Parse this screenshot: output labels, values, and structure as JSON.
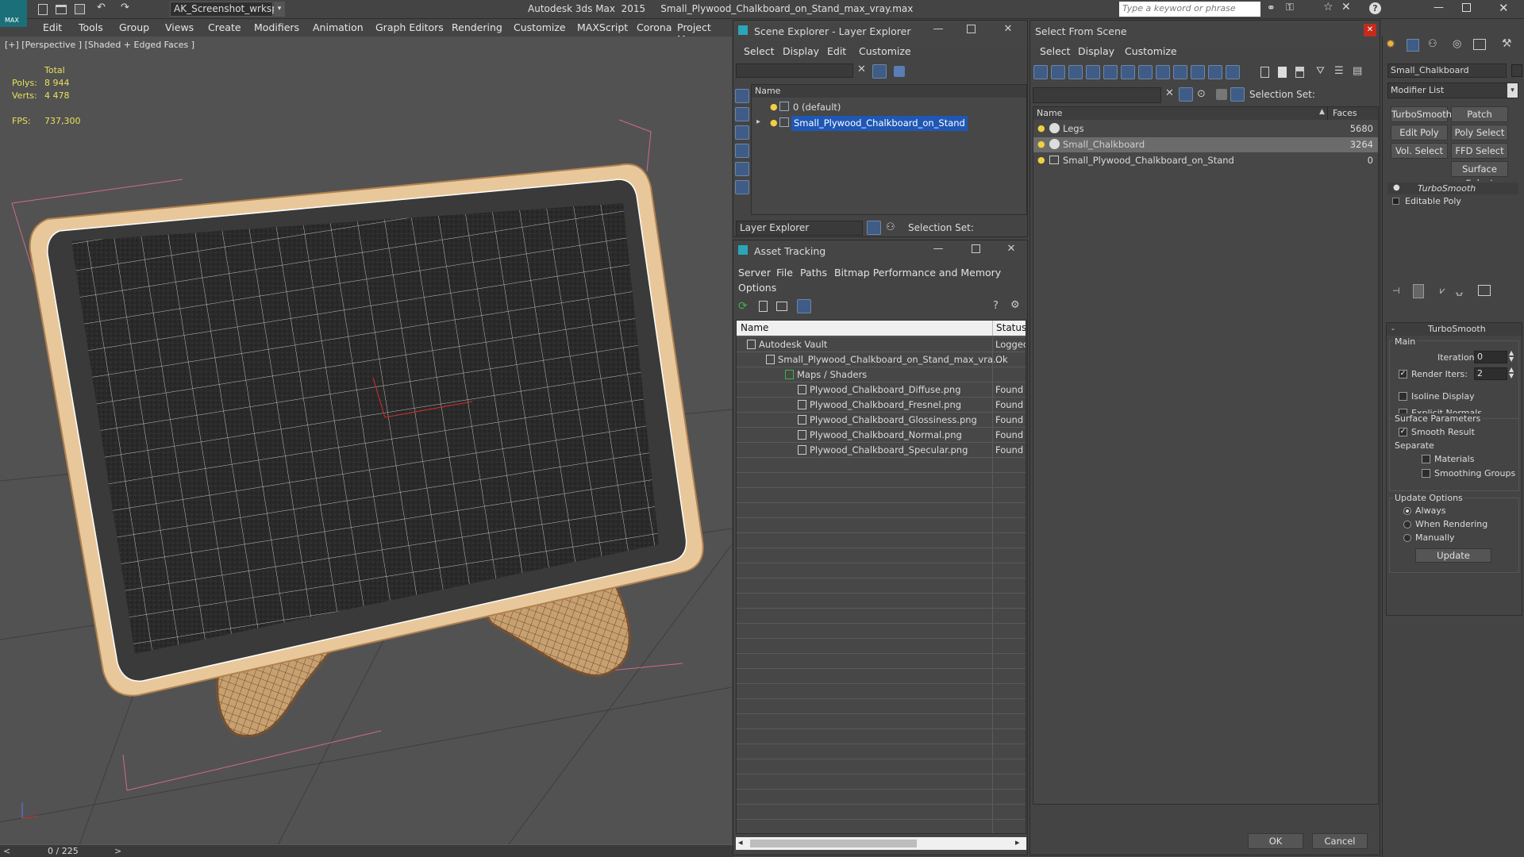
{
  "app": {
    "title": "Autodesk 3ds Max  2015     Small_Plywood_Chalkboard_on_Stand_max_vray.max",
    "workspace": "AK_Screenshot_wrksp",
    "search_placeholder": "Type a keyword or phrase",
    "logo_text": "MAX"
  },
  "menu": [
    "Edit",
    "Tools",
    "Group",
    "Views",
    "Create",
    "Modifiers",
    "Animation",
    "Graph Editors",
    "Rendering",
    "Customize",
    "MAXScript",
    "Corona",
    "Project Man"
  ],
  "viewport": {
    "label": "[+] [Perspective ] [Shaded + Edged Faces ]",
    "stats": {
      "total_label": "Total",
      "polys_label": "Polys:",
      "polys": "8 944",
      "verts_label": "Verts:",
      "verts": "4 478",
      "fps_label": "FPS:",
      "fps": "737,300"
    }
  },
  "timeline": {
    "frame": "0 / 225",
    "prev": "<",
    "next": ">"
  },
  "scene_explorer": {
    "title": "Scene Explorer - Layer Explorer",
    "menu": [
      "Select",
      "Display",
      "Edit",
      "Customize"
    ],
    "col_name": "Name",
    "rows": [
      "0 (default)",
      "Small_Plywood_Chalkboard_on_Stand"
    ],
    "footer_dropdown": "Layer Explorer",
    "selection_set": "Selection Set:"
  },
  "asset_tracking": {
    "title": "Asset Tracking",
    "menu": [
      "Server",
      "File",
      "Paths",
      "Bitmap Performance and Memory",
      "Options"
    ],
    "col_name": "Name",
    "col_status": "Status",
    "rows": [
      {
        "name": "Autodesk Vault",
        "status": "Logged"
      },
      {
        "name": "Small_Plywood_Chalkboard_on_Stand_max_vra...",
        "status": "Ok"
      },
      {
        "name": "Maps / Shaders",
        "status": ""
      },
      {
        "name": "Plywood_Chalkboard_Diffuse.png",
        "status": "Found"
      },
      {
        "name": "Plywood_Chalkboard_Fresnel.png",
        "status": "Found"
      },
      {
        "name": "Plywood_Chalkboard_Glossiness.png",
        "status": "Found"
      },
      {
        "name": "Plywood_Chalkboard_Normal.png",
        "status": "Found"
      },
      {
        "name": "Plywood_Chalkboard_Specular.png",
        "status": "Found"
      }
    ]
  },
  "select_from_scene": {
    "title": "Select From Scene",
    "menu": [
      "Select",
      "Display",
      "Customize"
    ],
    "selection_set": "Selection Set:",
    "col_name": "Name",
    "col_faces": "Faces",
    "rows": [
      {
        "name": "Legs",
        "faces": "5680"
      },
      {
        "name": "Small_Chalkboard",
        "faces": "3264"
      },
      {
        "name": "Small_Plywood_Chalkboard_on_Stand",
        "faces": "0"
      }
    ],
    "ok": "OK",
    "cancel": "Cancel"
  },
  "command_panel": {
    "object_name": "Small_Chalkboard",
    "modifier_list": "Modifier List",
    "buttons": [
      "TurboSmooth",
      "Patch Select",
      "Edit Poly",
      "Poly Select",
      "Vol. Select",
      "FFD Select",
      "Surface Select"
    ],
    "stack": [
      "TurboSmooth",
      "Editable Poly"
    ],
    "rollout": "TurboSmooth",
    "main": "Main",
    "iterations_label": "Iterations:",
    "iterations": "0",
    "render_iters_label": "Render Iters:",
    "render_iters": "2",
    "isoline": "Isoline Display",
    "explicit_normals": "Explicit Normals",
    "surface_params": "Surface Parameters",
    "smooth_result": "Smooth Result",
    "separate": "Separate",
    "materials": "Materials",
    "smoothing_groups": "Smoothing Groups",
    "update_options": "Update Options",
    "always": "Always",
    "when_rendering": "When Rendering",
    "manually": "Manually",
    "update": "Update"
  }
}
